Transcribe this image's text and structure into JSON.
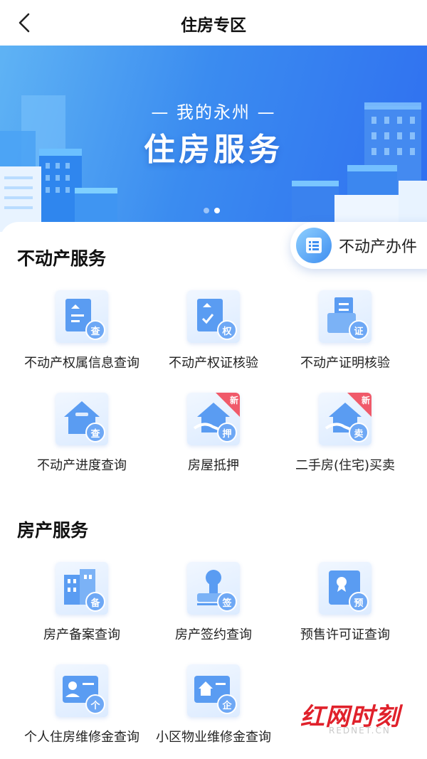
{
  "header": {
    "title": "住房专区"
  },
  "banner": {
    "subtitle": "— 我的永州 —",
    "title": "住房服务",
    "active_slide": 2,
    "slide_count": 2
  },
  "float_button": {
    "label": "不动产办件"
  },
  "sections": [
    {
      "title": "不动产服务",
      "items": [
        {
          "label": "不动产权属信息查询",
          "badge": "查",
          "icon": "property-doc-icon"
        },
        {
          "label": "不动产权证核验",
          "badge": "权",
          "icon": "certificate-check-icon"
        },
        {
          "label": "不动产证明核验",
          "badge": "证",
          "icon": "certificate-proof-icon"
        },
        {
          "label": "不动产进度查询",
          "badge": "查",
          "icon": "house-progress-icon"
        },
        {
          "label": "房屋抵押",
          "badge": "押",
          "tag": "新",
          "icon": "house-mortgage-icon"
        },
        {
          "label": "二手房(住宅)买卖",
          "badge": "卖",
          "tag": "新",
          "icon": "house-sale-icon"
        }
      ]
    },
    {
      "title": "房产服务",
      "items": [
        {
          "label": "房产备案查询",
          "badge": "备",
          "icon": "building-record-icon"
        },
        {
          "label": "房产签约查询",
          "badge": "签",
          "icon": "contract-stamp-icon"
        },
        {
          "label": "预售许可证查询",
          "badge": "预",
          "icon": "presale-license-icon"
        },
        {
          "label": "个人住房维修金查询",
          "badge": "个",
          "icon": "personal-fund-icon"
        },
        {
          "label": "小区物业维修金查询",
          "badge": "企",
          "icon": "community-fund-icon"
        }
      ]
    }
  ],
  "watermark": {
    "text": "红网时刻",
    "sub": "REDNET.CN"
  },
  "colors": {
    "primary": "#3b8cf0",
    "new_badge": "#f05a6a",
    "watermark": "#e0212b"
  }
}
